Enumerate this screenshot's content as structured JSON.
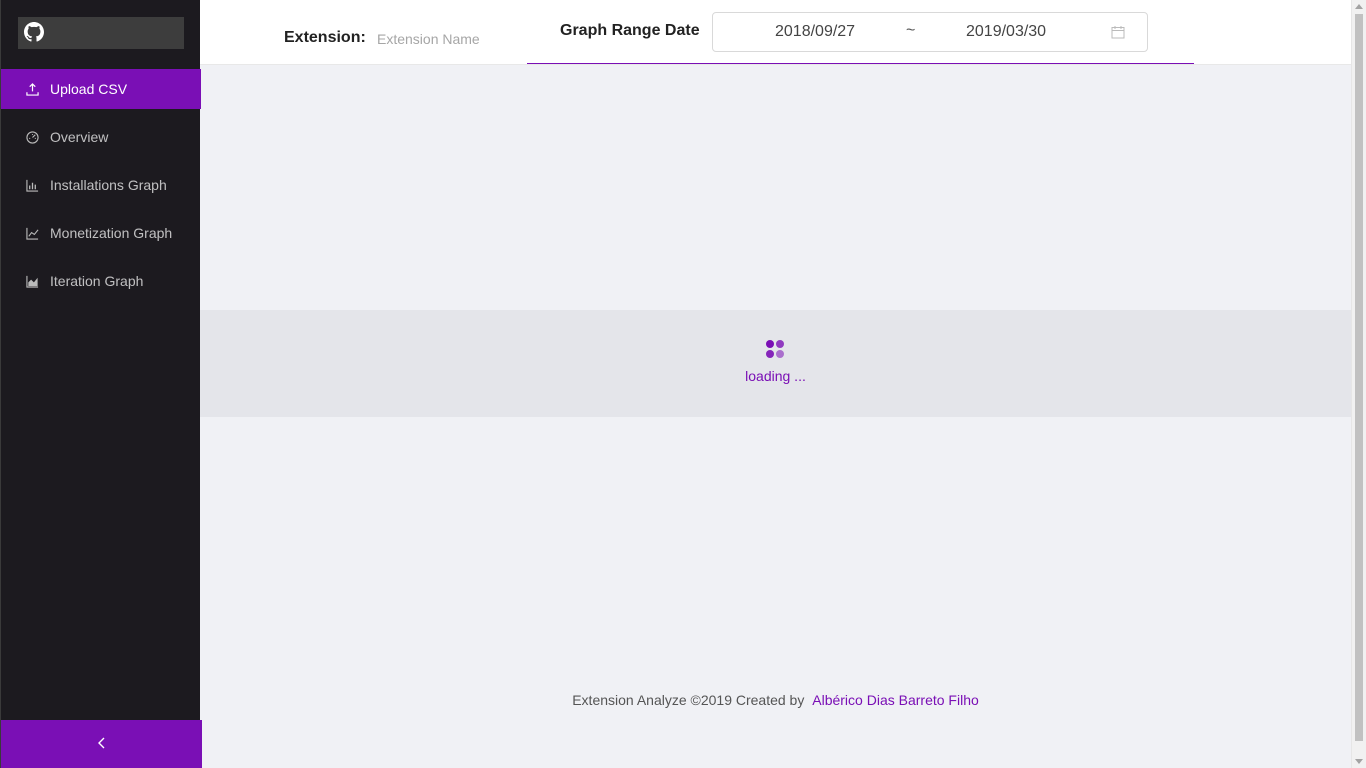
{
  "sidebar": {
    "logo_icon": "github-icon",
    "items": [
      {
        "label": "Upload CSV",
        "icon": "upload-icon",
        "active": true
      },
      {
        "label": "Overview",
        "icon": "dashboard-icon",
        "active": false
      },
      {
        "label": "Installations Graph",
        "icon": "bar-chart-icon",
        "active": false
      },
      {
        "label": "Monetization Graph",
        "icon": "line-chart-icon",
        "active": false
      },
      {
        "label": "Iteration Graph",
        "icon": "area-chart-icon",
        "active": false
      }
    ],
    "collapse_icon": "chevron-left-icon"
  },
  "header": {
    "extension_label": "Extension:",
    "extension_placeholder": "Extension Name",
    "extension_value": "",
    "range_label": "Graph Range Date",
    "range_start": "2018/09/27",
    "range_separator": "~",
    "range_end": "2019/03/30",
    "calendar_icon": "calendar-icon"
  },
  "main": {
    "loading_text": "loading ..."
  },
  "footer": {
    "text": "Extension Analyze ©2019 Created by",
    "author_link": "Albérico Dias Barreto Filho"
  },
  "colors": {
    "accent": "#7a0fb5",
    "sidebar_bg": "#1c1a1f",
    "content_bg": "#f0f1f5",
    "header_bg": "#ffffff"
  }
}
